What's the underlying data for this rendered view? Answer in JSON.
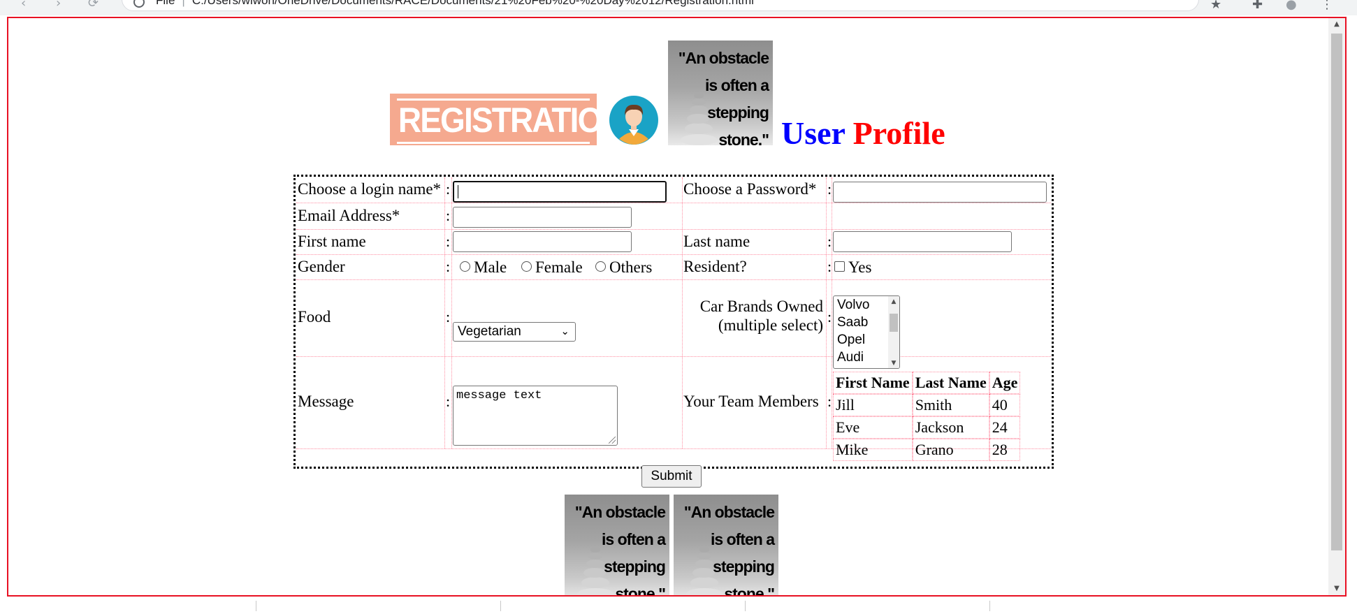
{
  "browser": {
    "scheme": "File",
    "url": "C:/Users/wiwon/OneDrive/Documents/RACE/Documents/21%20Feb%20-%20Day%2012/Registration.html"
  },
  "header": {
    "banner_text": "REGISTRATION",
    "quote_text": "\"An obstacle is often a stepping stone.\"",
    "title_part1": "User",
    "title_part2": "Profile"
  },
  "form": {
    "login_label": "Choose a login name*",
    "password_label": "Choose a Password*",
    "email_label": "Email Address*",
    "first_name_label": "First name",
    "last_name_label": "Last name",
    "gender_label": "Gender",
    "gender_options": [
      "Male",
      "Female",
      "Others"
    ],
    "resident_label": "Resident?",
    "resident_option": "Yes",
    "food_label": "Food",
    "food_selected": "Vegetarian",
    "car_label_line1": "Car Brands Owned",
    "car_label_line2": "(multiple select)",
    "car_options": [
      "Volvo",
      "Saab",
      "Opel",
      "Audi"
    ],
    "message_label": "Message",
    "message_value": "message text",
    "team_label": "Your Team Members",
    "team_headers": [
      "First Name",
      "Last Name",
      "Age"
    ],
    "team_rows": [
      [
        "Jill",
        "Smith",
        "40"
      ],
      [
        "Eve",
        "Jackson",
        "24"
      ],
      [
        "Mike",
        "Grano",
        "28"
      ]
    ],
    "colon": ":",
    "submit_label": "Submit"
  },
  "colors": {
    "title_user": "#0000ff",
    "title_profile": "#ff0000",
    "viewport_border": "#e81123",
    "banner_bg": "#f5a98f"
  }
}
